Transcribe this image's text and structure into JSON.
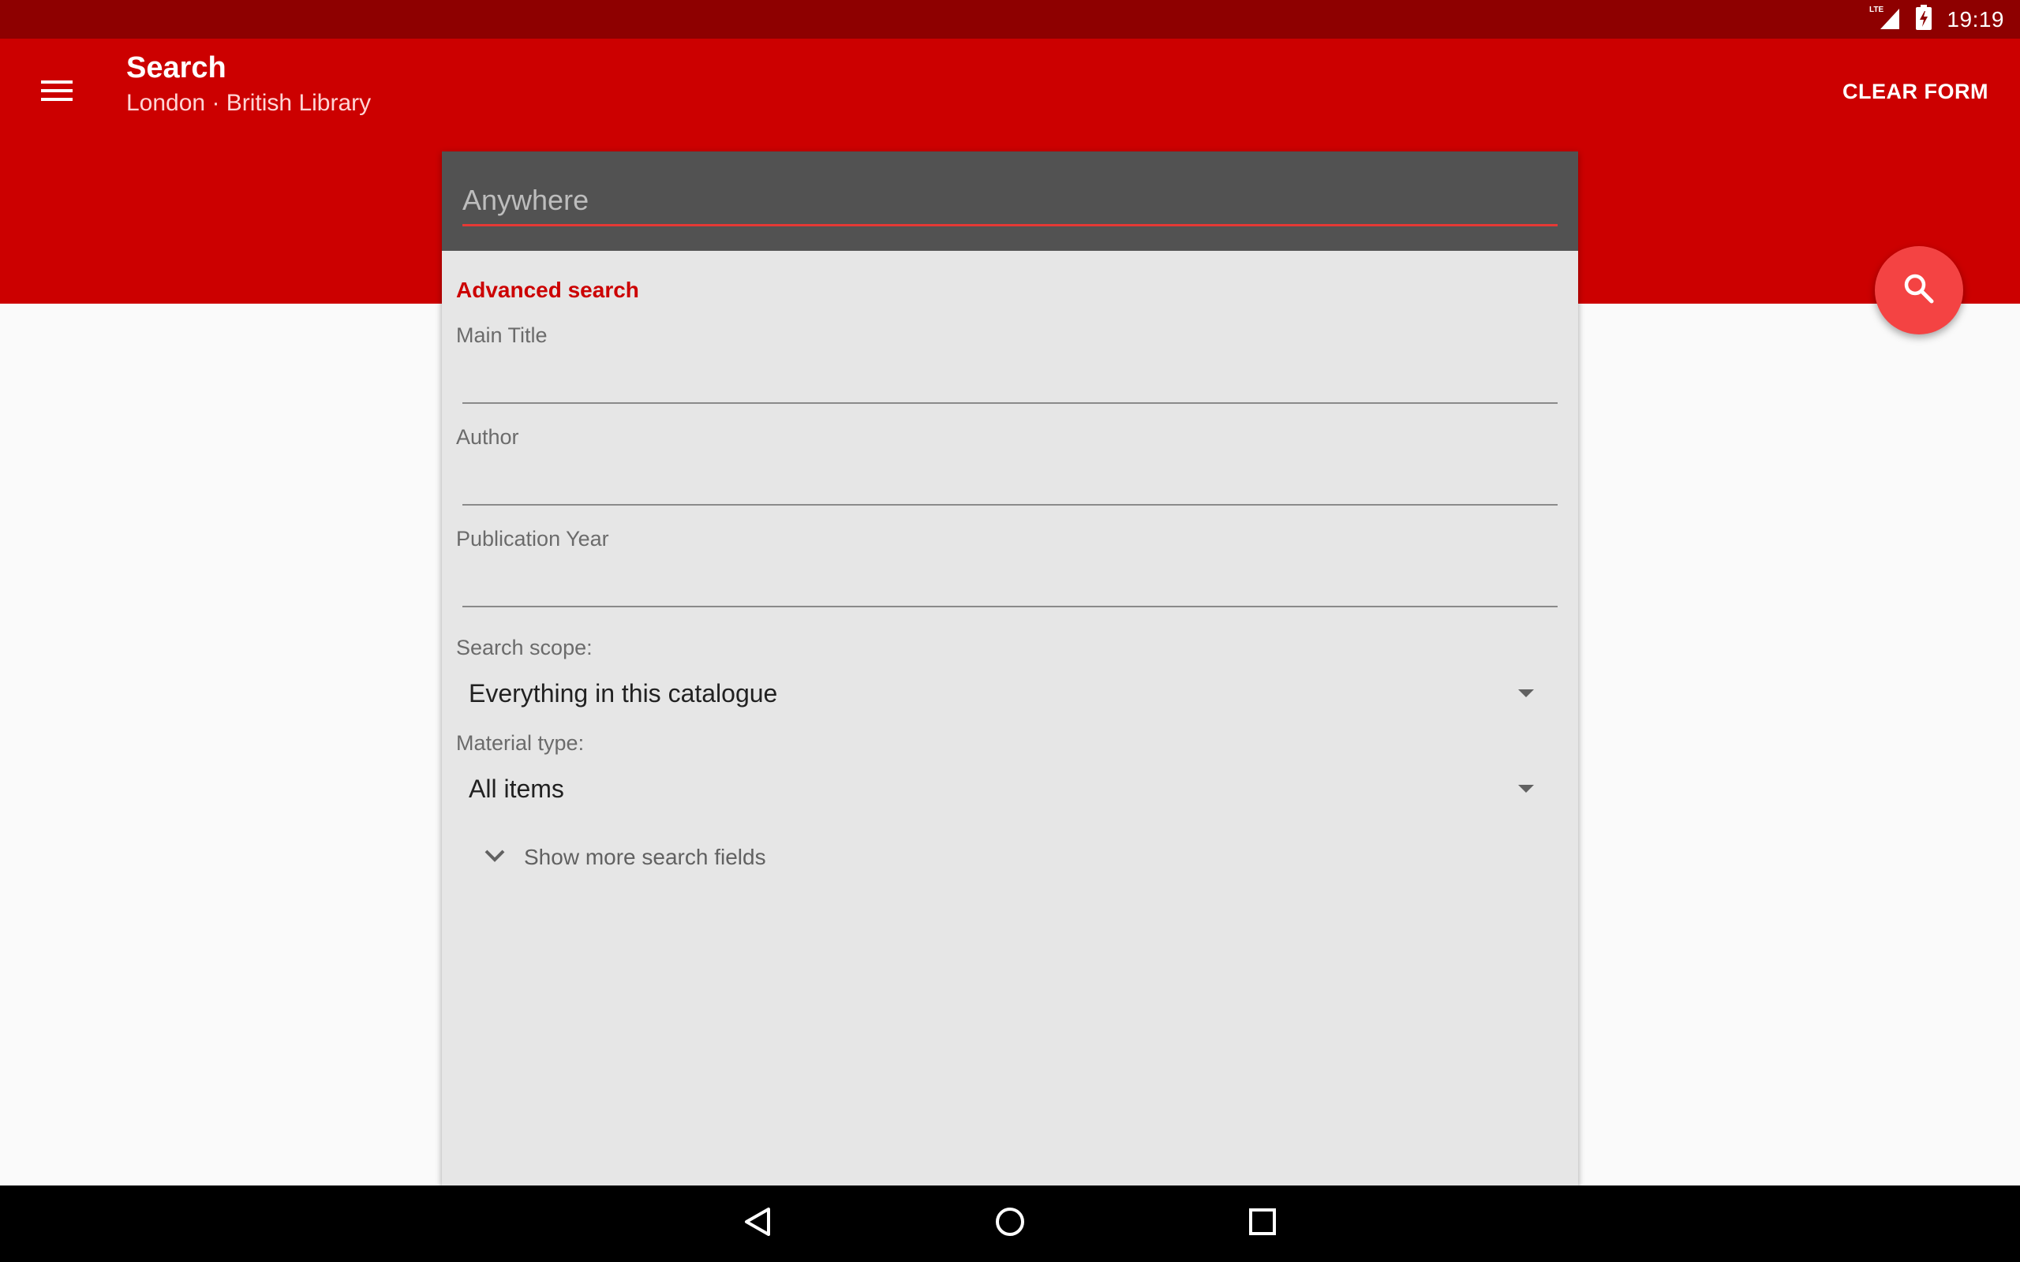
{
  "status_bar": {
    "network": "LTE",
    "time": "19:19"
  },
  "app_bar": {
    "title": "Search",
    "subtitle": "London · British Library",
    "clear_label": "CLEAR FORM"
  },
  "search": {
    "anywhere_placeholder": "Anywhere",
    "advanced_title": "Advanced search",
    "main_title_label": "Main Title",
    "author_label": "Author",
    "year_label": "Publication Year",
    "scope_label": "Search scope:",
    "scope_value": "Everything in this catalogue",
    "material_label": "Material type:",
    "material_value": "All items",
    "more_fields_label": "Show more search fields"
  },
  "colors": {
    "status_bar": "#8e0000",
    "app_bar": "#cc0000",
    "accent": "#f44343",
    "card": "#e6e6e6",
    "card_header": "#525252"
  },
  "icons": {
    "menu": "menu-icon",
    "search_fab": "search-icon",
    "expand": "chevron-down-icon",
    "back": "back-icon",
    "home": "home-icon",
    "recents": "recents-icon"
  }
}
